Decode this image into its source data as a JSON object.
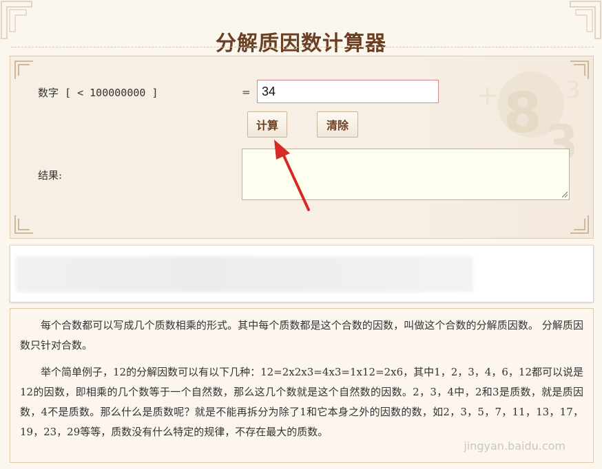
{
  "page": {
    "title": "分解质因数计算器"
  },
  "calculator": {
    "number_label": "数字 [ < 100000000 ]",
    "equals": "=",
    "input_value": "34",
    "calc_button": "计算",
    "clear_button": "清除",
    "result_label": "结果:",
    "result_value": ""
  },
  "description": {
    "paragraphs": [
      "每个合数都可以写成几个质数相乘的形式。其中每个质数都是这个合数的因数，叫做这个合数的分解质因数。 分解质因数只针对合数。",
      "举个简单例子，12的分解因数可以有以下几种：12=2x2x3=4x3=1x12=2x6，其中1，2，3，4，6，12都可以说是12的因数，即相乘的几个数等于一个自然数，那么这几个数就是这个自然数的因数。2，3，4中，2和3是质数，就是质因数，4不是质数。那么什么是质数呢？就是不能再拆分为除了1和它本身之外的因数的数，如2，3，5，7，11，13，17，19，23，29等等，质数没有什么特定的规律，不存在最大的质数。"
    ]
  },
  "watermark": {
    "text": "jingyan.baidu.com"
  },
  "colors": {
    "title": "#6b3e23",
    "panel_bg": "#f7efe3",
    "input_border": "#d9888a",
    "result_bg": "#fffff0",
    "arrow": "#d62b24"
  }
}
